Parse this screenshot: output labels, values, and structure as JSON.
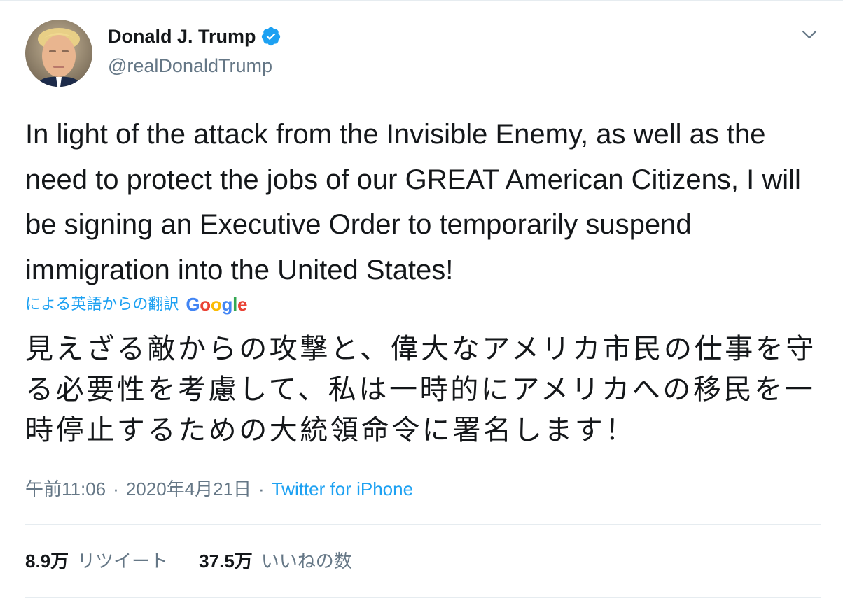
{
  "author": {
    "name": "Donald J. Trump",
    "handle": "@realDonaldTrump",
    "verified": true,
    "avatar_icon": "profile-photo"
  },
  "tweet": {
    "text": "In light of the attack from the Invisible Enemy, as well as the need to protect the jobs of our GREAT American Citizens, I will be signing an Executive Order to temporarily suspend immigration into the United States!",
    "translation_label": "による英語からの翻訳",
    "translation_provider": "Google",
    "translated_text": "見えざる敵からの攻撃と、偉大なアメリカ市民の仕事を守る必要性を考慮して、私は一時的にアメリカへの移民を一時停止するための大統領命令に署名します！"
  },
  "meta": {
    "time": "午前11:06",
    "separator": "·",
    "date": "2020年4月21日",
    "source": "Twitter for iPhone"
  },
  "stats": {
    "retweets_count": "8.9万",
    "retweets_label": "リツイート",
    "likes_count": "37.5万",
    "likes_label": "いいねの数"
  },
  "colors": {
    "accent": "#1da1f2",
    "text": "#14171a",
    "secondary": "#657786",
    "divider": "#e6ecf0"
  }
}
